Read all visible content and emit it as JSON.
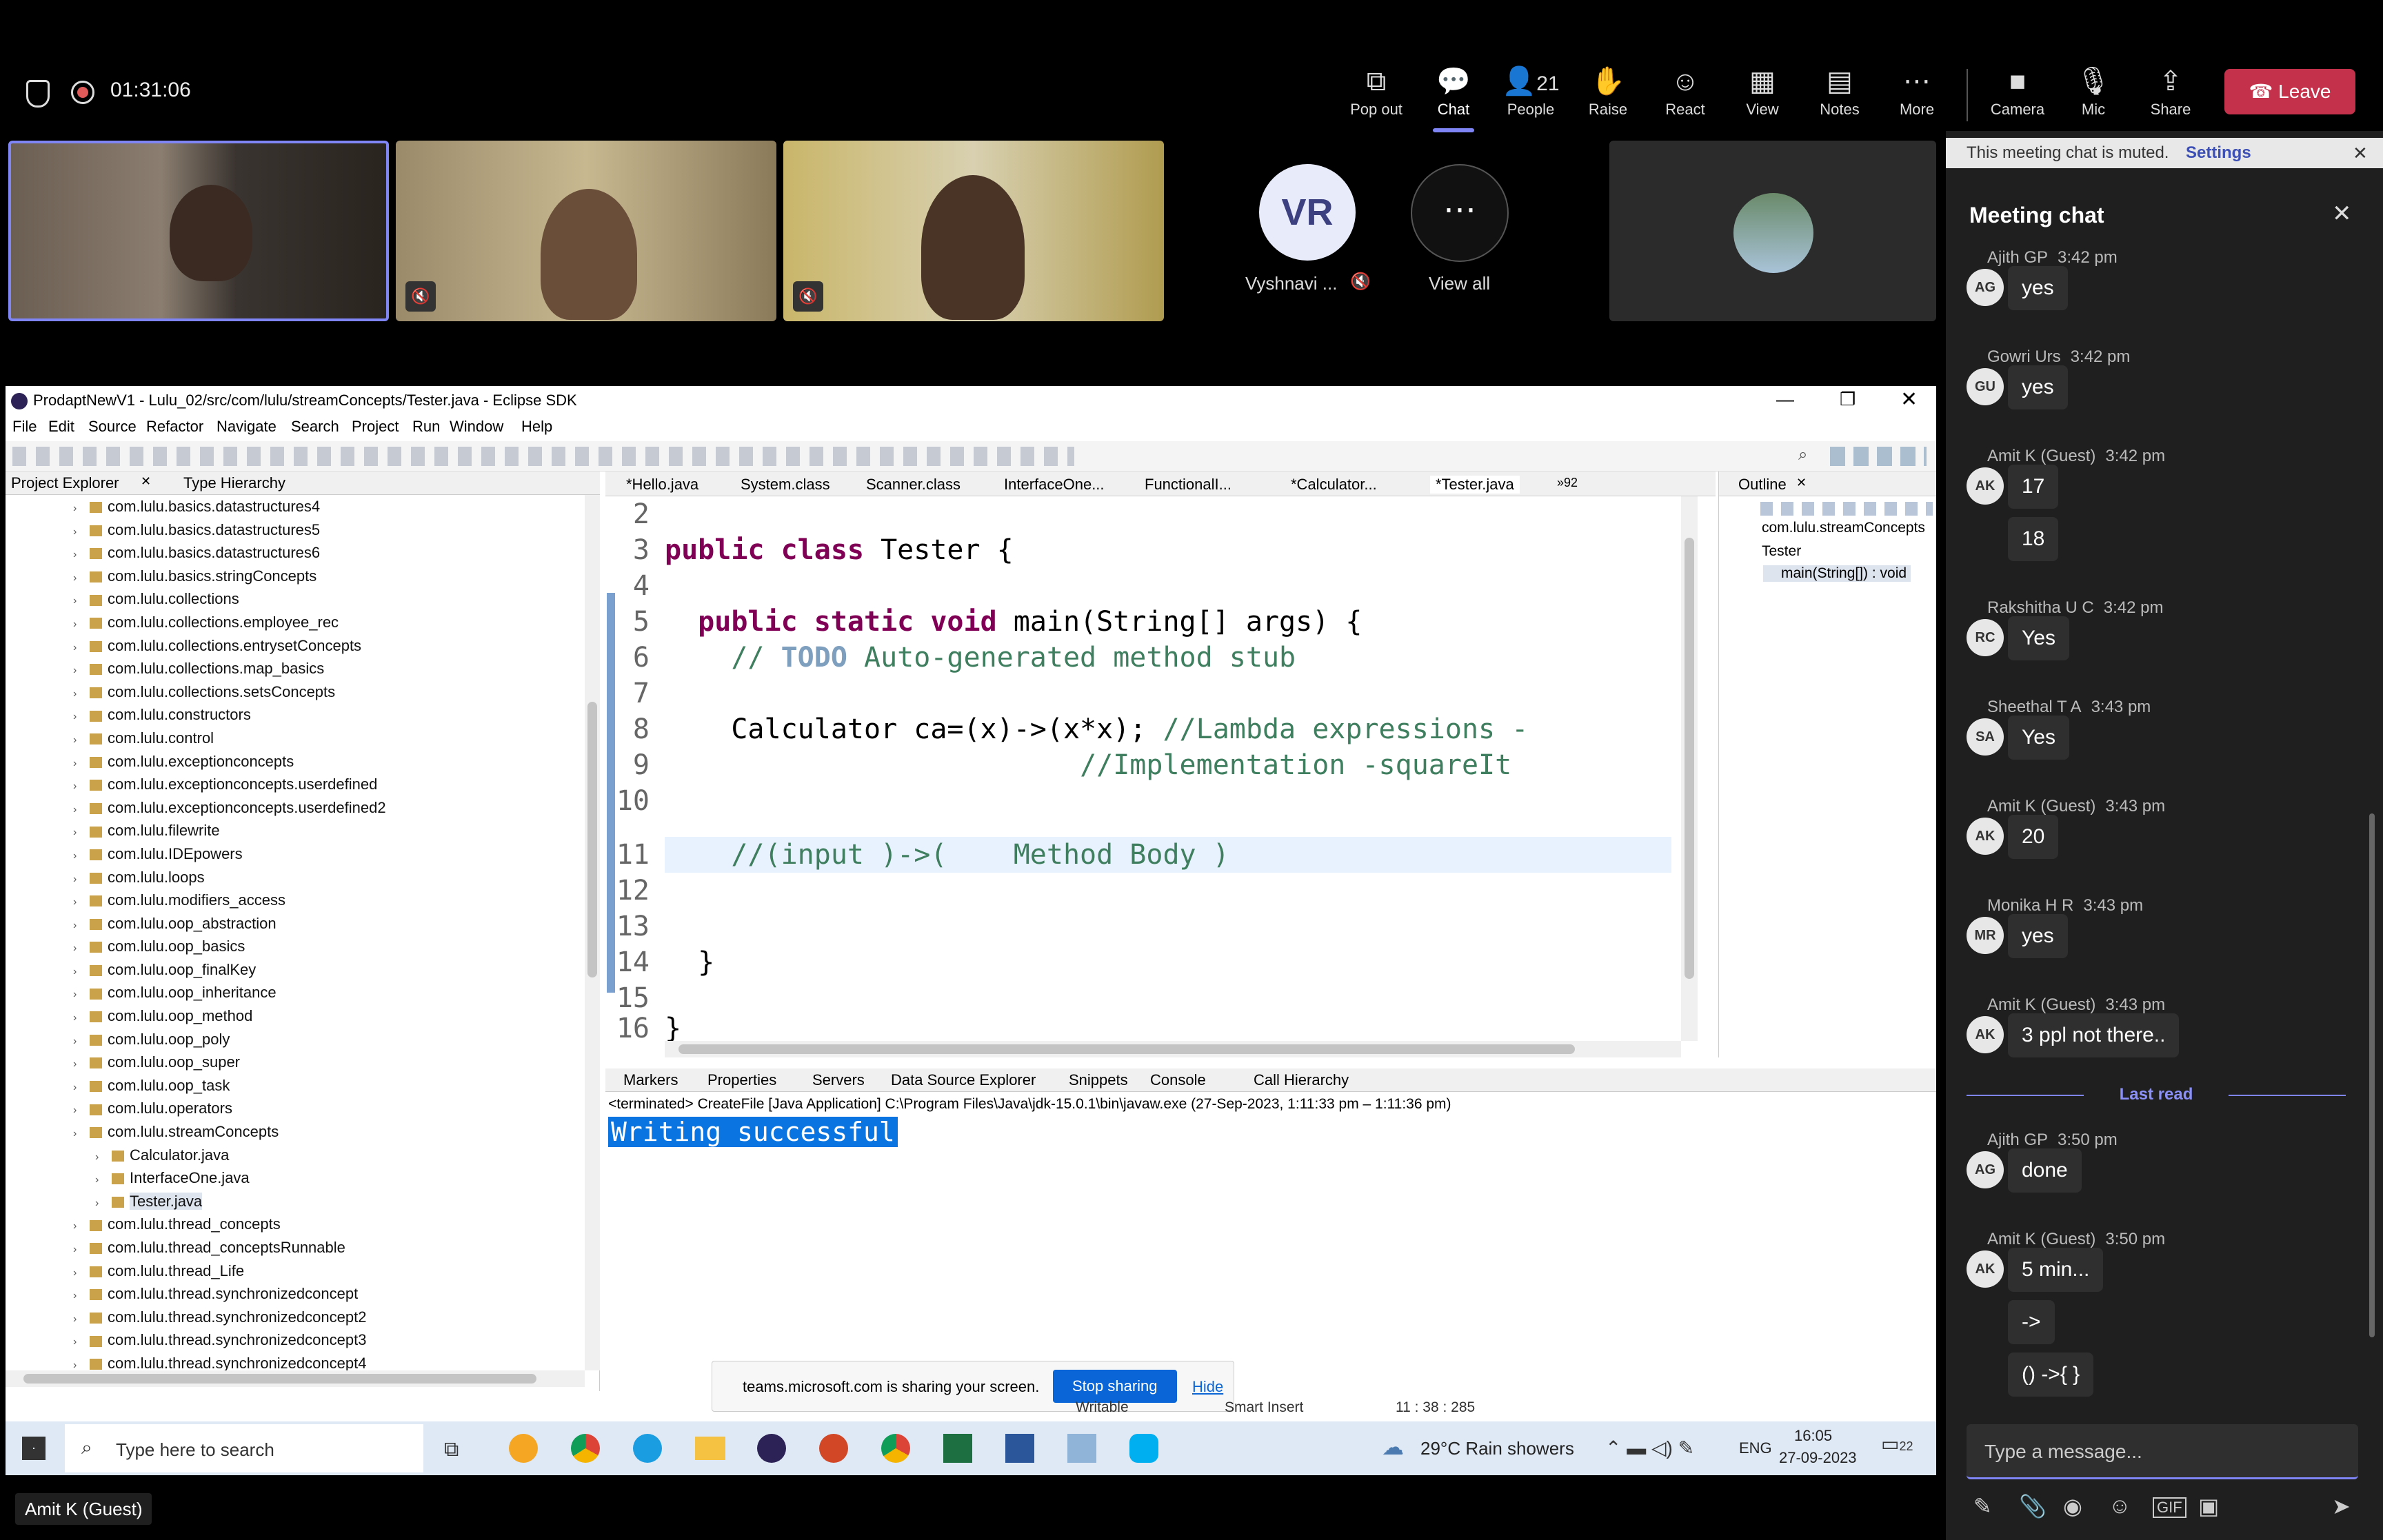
{
  "meeting": {
    "timer": "01:31:06",
    "toolbar": [
      {
        "label": "Pop out",
        "icon": "pop-out-icon"
      },
      {
        "label": "Chat",
        "icon": "chat-icon"
      },
      {
        "label": "People",
        "icon": "people-icon",
        "count": "21"
      },
      {
        "label": "Raise",
        "icon": "raise-hand-icon"
      },
      {
        "label": "React",
        "icon": "react-icon"
      },
      {
        "label": "View",
        "icon": "view-icon"
      },
      {
        "label": "Notes",
        "icon": "notes-icon"
      },
      {
        "label": "More",
        "icon": "more-icon"
      },
      {
        "label": "Camera",
        "icon": "camera-off-icon"
      },
      {
        "label": "Mic",
        "icon": "mic-off-icon"
      },
      {
        "label": "Share",
        "icon": "share-icon"
      }
    ],
    "leave_label": "Leave",
    "participants": {
      "vr_initials": "VR",
      "vr_name": "Vyshnavi ...",
      "view_all": "View all"
    },
    "speaker_label": "Amit K (Guest)",
    "colors": {
      "accent": "#7f85f5",
      "leave": "#c4314b"
    }
  },
  "chat": {
    "muted_notice": "This meeting chat is muted.",
    "settings_link": "Settings",
    "title": "Meeting chat",
    "last_read": "Last read",
    "input_placeholder": "Type a message...",
    "messages": [
      {
        "author": "Ajith GP",
        "time": "3:42 pm",
        "initials": "AG",
        "texts": [
          "yes"
        ]
      },
      {
        "author": "Gowri Urs",
        "time": "3:42 pm",
        "initials": "GU",
        "texts": [
          "yes"
        ]
      },
      {
        "author": "Amit K (Guest)",
        "time": "3:42 pm",
        "initials": "AK",
        "texts": [
          "17",
          "18"
        ]
      },
      {
        "author": "Rakshitha U C",
        "time": "3:42 pm",
        "initials": "RC",
        "texts": [
          "Yes"
        ]
      },
      {
        "author": "Sheethal T A",
        "time": "3:43 pm",
        "initials": "SA",
        "texts": [
          "Yes"
        ]
      },
      {
        "author": "Amit K (Guest)",
        "time": "3:43 pm",
        "initials": "AK",
        "texts": [
          "20"
        ]
      },
      {
        "author": "Monika H R",
        "time": "3:43 pm",
        "initials": "MR",
        "texts": [
          "yes"
        ]
      },
      {
        "author": "Amit K (Guest)",
        "time": "3:43 pm",
        "initials": "AK",
        "texts": [
          "3 ppl not there.."
        ]
      },
      {
        "author": "Ajith GP",
        "time": "3:50 pm",
        "initials": "AG",
        "texts": [
          "done"
        ]
      },
      {
        "author": "Amit K (Guest)",
        "time": "3:50 pm",
        "initials": "AK",
        "texts": [
          "5 min...",
          "->",
          "() ->{  }"
        ]
      }
    ]
  },
  "eclipse": {
    "title": "ProdaptNewV1 - Lulu_02/src/com/lulu/streamConcepts/Tester.java - Eclipse SDK",
    "menu": [
      "File",
      "Edit",
      "Source",
      "Refactor",
      "Navigate",
      "Search",
      "Project",
      "Run",
      "Window",
      "Help"
    ],
    "left_tabs": [
      "Project Explorer",
      "Type Hierarchy"
    ],
    "packages": [
      "com.lulu.basics.datastructures4",
      "com.lulu.basics.datastructures5",
      "com.lulu.basics.datastructures6",
      "com.lulu.basics.stringConcepts",
      "com.lulu.collections",
      "com.lulu.collections.employee_rec",
      "com.lulu.collections.entrysetConcepts",
      "com.lulu.collections.map_basics",
      "com.lulu.collections.setsConcepts",
      "com.lulu.constructors",
      "com.lulu.control",
      "com.lulu.exceptionconcepts",
      "com.lulu.exceptionconcepts.userdefined",
      "com.lulu.exceptionconcepts.userdefined2",
      "com.lulu.filewrite",
      "com.lulu.IDEpowers",
      "com.lulu.loops",
      "com.lulu.modifiers_access",
      "com.lulu.oop_abstraction",
      "com.lulu.oop_basics",
      "com.lulu.oop_finalKey",
      "com.lulu.oop_inheritance",
      "com.lulu.oop_method",
      "com.lulu.oop_poly",
      "com.lulu.oop_super",
      "com.lulu.oop_task",
      "com.lulu.operators",
      "com.lulu.streamConcepts"
    ],
    "stream_files": [
      "Calculator.java",
      "InterfaceOne.java",
      "Tester.java"
    ],
    "packages_after": [
      "com.lulu.thread_concepts",
      "com.lulu.thread_conceptsRunnable",
      "com.lulu.thread_Life",
      "com.lulu.thread.synchronizedconcept",
      "com.lulu.thread.synchronizedconcept2",
      "com.lulu.thread.synchronizedconcept3",
      "com.lulu.thread.synchronizedconcept4"
    ],
    "editor_tabs": [
      "*Hello.java",
      "System.class",
      "Scanner.class",
      "InterfaceOne...",
      "FunctionalI...",
      "*Calculator...",
      "*Tester.java",
      "»92"
    ],
    "outline_tab": "Outline",
    "outline": [
      "com.lulu.streamConcepts",
      "Tester",
      "main(String[]) : void"
    ],
    "bottom_tabs": [
      "Markers",
      "Properties",
      "Servers",
      "Data Source Explorer",
      "Snippets",
      "Console",
      "Call Hierarchy"
    ],
    "console_header": "<terminated> CreateFile [Java Application] C:\\Program Files\\Java\\jdk-15.0.1\\bin\\javaw.exe  (27-Sep-2023, 1:11:33 pm – 1:11:36 pm)",
    "console_output": "Writing successful",
    "status_insert": "Smart Insert",
    "status_pos": "11 : 38 : 285",
    "status_writable": "Writable"
  },
  "code": {
    "line_numbers": [
      "2",
      "3",
      "4",
      "5",
      "6",
      "7",
      "8",
      "9",
      "10",
      "11",
      "12",
      "13",
      "14",
      "15",
      "16"
    ],
    "l3_kw": "public class",
    "l3_rest": " Tester {",
    "l5_kw": "public static void",
    "l5_rest": " main(String[] args) {",
    "l6_cm": "// ",
    "l6_task": "TODO",
    "l6_rest": " Auto-generated method stub",
    "l8_code": "Calculator ca=(x)->(x*x); ",
    "l8_cm": "//Lambda expressions -",
    "l9_cm": "//Implementation -squareIt",
    "l11_cm": "//(input )->(    Method Body )",
    "l14": "}",
    "l16": "}"
  },
  "sharing": {
    "notice": "teams.microsoft.com is sharing your screen.",
    "stop": "Stop sharing",
    "hide": "Hide"
  },
  "taskbar": {
    "search_placeholder": "Type here to search",
    "weather": "29°C  Rain showers",
    "lang": "ENG",
    "time": "16:05",
    "date": "27-09-2023",
    "notif_count": "22"
  }
}
